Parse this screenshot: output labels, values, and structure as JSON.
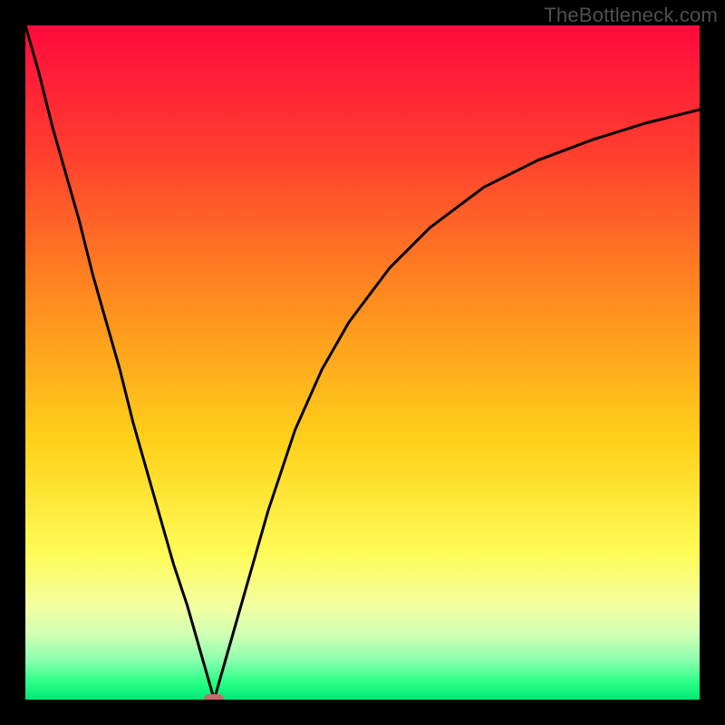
{
  "watermark": "TheBottleneck.com",
  "colors": {
    "frame": "#000000",
    "gradient_stops": [
      {
        "offset": 0.0,
        "color": "#ff0a3c"
      },
      {
        "offset": 0.18,
        "color": "#ff3b2f"
      },
      {
        "offset": 0.4,
        "color": "#ff8a1f"
      },
      {
        "offset": 0.62,
        "color": "#ffd21a"
      },
      {
        "offset": 0.78,
        "color": "#fffb55"
      },
      {
        "offset": 0.86,
        "color": "#f3ffa0"
      },
      {
        "offset": 0.9,
        "color": "#d4ffb3"
      },
      {
        "offset": 0.94,
        "color": "#8fffb0"
      },
      {
        "offset": 0.975,
        "color": "#29ff85"
      },
      {
        "offset": 1.0,
        "color": "#00e874"
      }
    ],
    "curve": "#000000",
    "marker_fill": "#c76a6a"
  },
  "chart_data": {
    "type": "line",
    "title": "",
    "xlabel": "",
    "ylabel": "",
    "xlim": [
      0,
      100
    ],
    "ylim": [
      0,
      100
    ],
    "grid": false,
    "legend": false,
    "series": [
      {
        "name": "curve",
        "x": [
          0,
          2,
          4,
          6,
          8,
          10,
          12,
          14,
          16,
          18,
          20,
          22,
          24,
          26,
          27,
          28,
          29,
          30,
          32,
          34,
          36,
          38,
          40,
          44,
          48,
          54,
          60,
          68,
          76,
          84,
          92,
          100
        ],
        "y": [
          100,
          93,
          85,
          78,
          71,
          63,
          56,
          49,
          41,
          34,
          27,
          20,
          14,
          7,
          3.5,
          0,
          3.5,
          7,
          14,
          21,
          28,
          34,
          40,
          49,
          56,
          64,
          70,
          76,
          80,
          83,
          85.5,
          87.5
        ]
      }
    ],
    "marker": {
      "x": 28,
      "y": 0
    },
    "note": "V-shaped bottleneck curve. x and y are percentages of the plot area width/height with origin at bottom-left. Left branch is near-linear from (0,100) down to the minimum at x≈28; right branch rises with diminishing slope toward ~87.5% at the right edge."
  }
}
